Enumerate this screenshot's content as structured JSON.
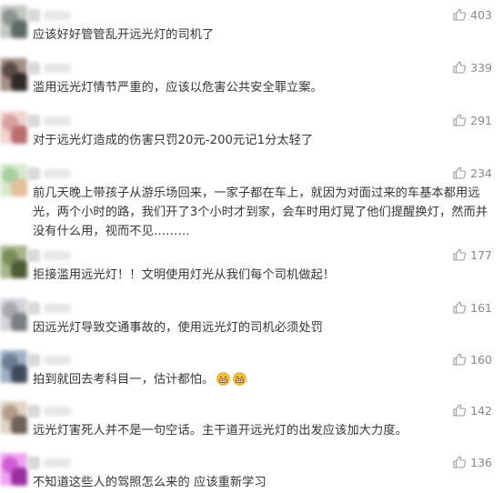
{
  "comments": [
    {
      "text": "应该好好管管乱开远光灯的司机了",
      "likes": "403",
      "avatar": [
        "#8d9490",
        "#c3c7c2",
        "#5f6a66"
      ]
    },
    {
      "text": "滥用远光灯情节严重的，应该以危害公共安全罪立案。",
      "likes": "339",
      "avatar": [
        "#5b4b45",
        "#a58f87",
        "#2e2a28"
      ]
    },
    {
      "text": "对于远光灯造成的伤害只罚20元-200元记1分太轻了",
      "likes": "291",
      "avatar": [
        "#d9a0a0",
        "#f0d4cf",
        "#b86e6e"
      ]
    },
    {
      "text": "前几天晚上带孩子从游乐场回来，一家子都在车上，就因为对面过来的车基本都用远光，两个小时的路，我们开了3个小时才到家，会车时用灯晃了他们提醒换灯，然而并没有什么用，视而不见………",
      "likes": "234",
      "avatar": [
        "#a9cfa0",
        "#d6e9cf",
        "#e2c19a"
      ]
    },
    {
      "text": "拒接滥用远光灯！！文明使用灯光从我们每个司机做起！",
      "likes": "177",
      "avatar": [
        "#7c8d5a",
        "#a7b58a",
        "#4d5c36"
      ]
    },
    {
      "text": "因远光灯导致交通事故的，使用远光灯的司机必须处罚",
      "likes": "161",
      "avatar": [
        "#a7a9ad",
        "#d3d4d7",
        "#7b7e84"
      ]
    },
    {
      "text": "拍到就回去考科目一，估计都怕。",
      "likes": "160",
      "avatar": [
        "#6c7e95",
        "#9fb0c2",
        "#3f4b5c"
      ]
    },
    {
      "text": "远光灯害死人并不是一句空话。主干道开远光灯的出发应该加大力度。",
      "likes": "142",
      "avatar": [
        "#b29d8a",
        "#e0d4c6",
        "#6f6258"
      ]
    },
    {
      "text": "不知道这些人的驾照怎么来的 应该重新学习",
      "likes": "136",
      "avatar": [
        "#d25ad6",
        "#f0a3f2",
        "#9b2fa0"
      ]
    }
  ],
  "emoji_names": [
    "grin-emoji",
    "grin-emoji"
  ],
  "like_icon": "thumbs-up-icon",
  "colors": {
    "text": "#353535",
    "like_count": "#888888",
    "background": "#ffffff"
  }
}
